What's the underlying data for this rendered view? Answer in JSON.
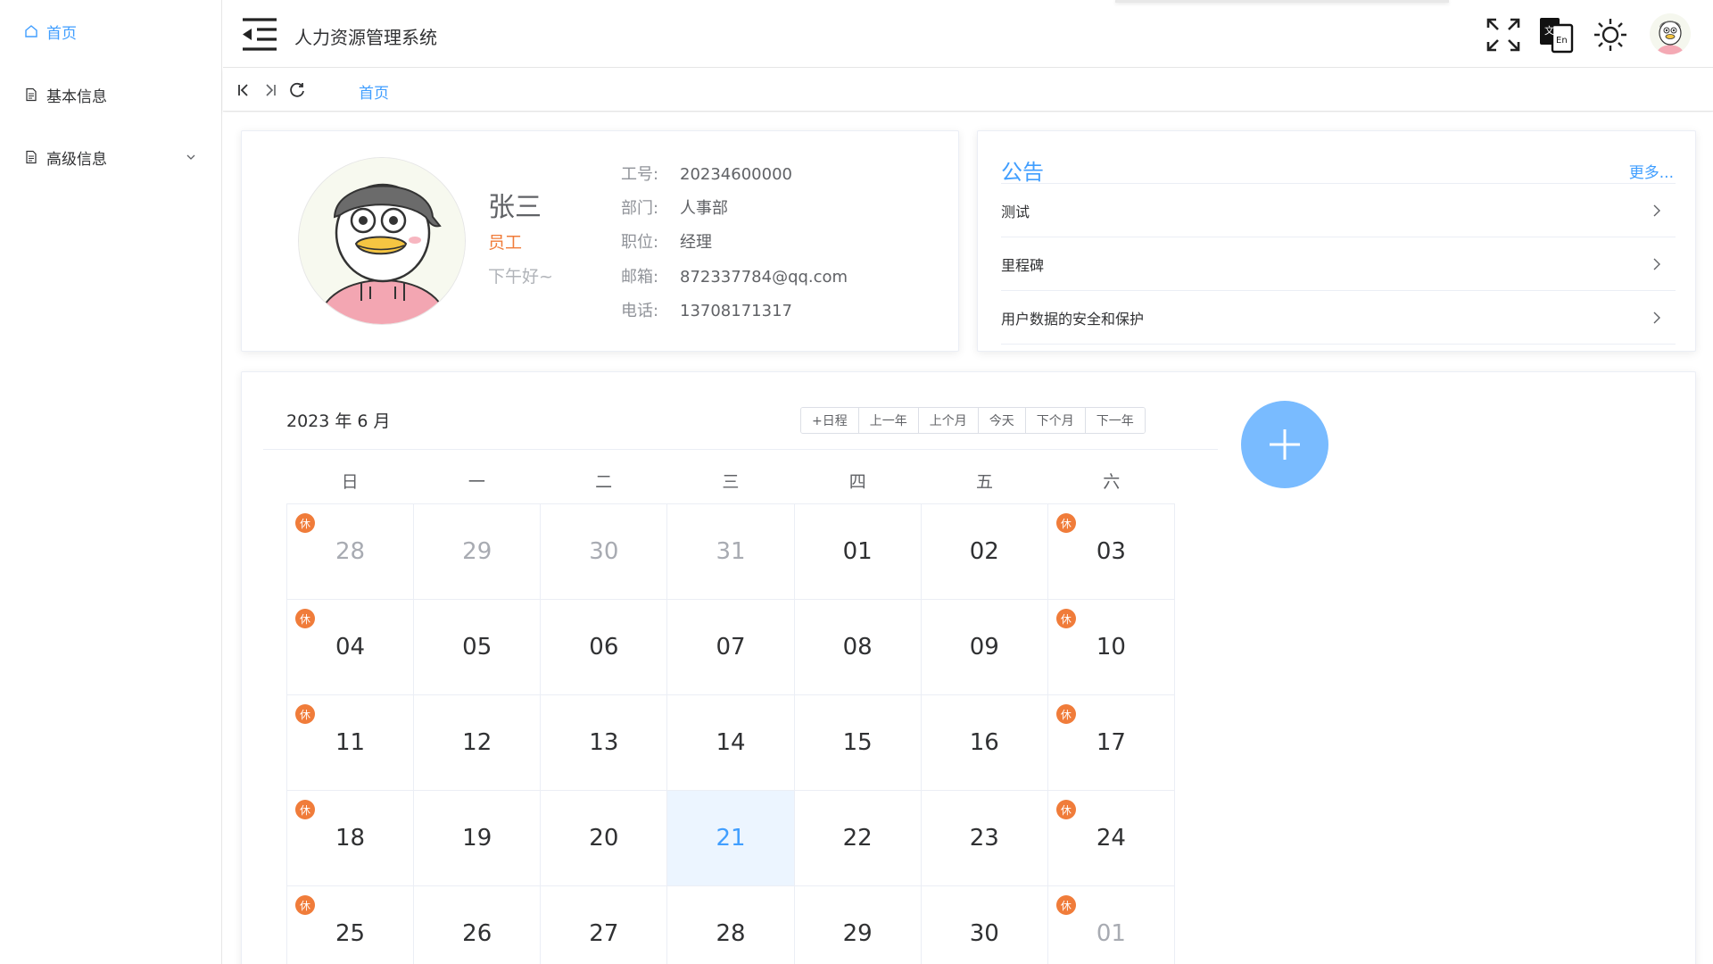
{
  "sidebar": {
    "items": [
      {
        "label": "首页",
        "icon": "home-icon",
        "active": true
      },
      {
        "label": "基本信息",
        "icon": "document-icon"
      },
      {
        "label": "高级信息",
        "icon": "document-icon",
        "expandable": true
      }
    ]
  },
  "header": {
    "title": "人力资源管理系统",
    "icons": [
      "menu-fold-icon",
      "fullscreen-icon",
      "translate-icon",
      "sun-icon",
      "avatar"
    ],
    "translate_glyphs": {
      "zh": "文",
      "en": "En"
    }
  },
  "tabs": {
    "controls": [
      "first-page-icon",
      "last-page-icon",
      "refresh-icon"
    ],
    "items": [
      {
        "label": "首页",
        "active": true
      }
    ]
  },
  "profile": {
    "name": "张三",
    "role": "员工",
    "greeting": "下午好~",
    "fields": [
      {
        "label": "工号:",
        "value": "20234600000"
      },
      {
        "label": "部门:",
        "value": "人事部"
      },
      {
        "label": "职位:",
        "value": "经理"
      },
      {
        "label": "邮箱:",
        "value": "872337784@qq.com"
      },
      {
        "label": "电话:",
        "value": "13708171317"
      }
    ]
  },
  "notice": {
    "title": "公告",
    "more": "更多...",
    "items": [
      "测试",
      "里程碑",
      "用户数据的安全和保护"
    ]
  },
  "calendar": {
    "title": "2023 年 6 月",
    "buttons": [
      "+日程",
      "上一年",
      "上个月",
      "今天",
      "下个月",
      "下一年"
    ],
    "weekdays": [
      "日",
      "一",
      "二",
      "三",
      "四",
      "五",
      "六"
    ],
    "rest_badge": "休",
    "weeks": [
      [
        "28",
        "29",
        "30",
        "31",
        "01",
        "02",
        "03"
      ],
      [
        "04",
        "05",
        "06",
        "07",
        "08",
        "09",
        "10"
      ],
      [
        "11",
        "12",
        "13",
        "14",
        "15",
        "16",
        "17"
      ],
      [
        "18",
        "19",
        "20",
        "21",
        "22",
        "23",
        "24"
      ],
      [
        "25",
        "26",
        "27",
        "28",
        "29",
        "30",
        "01"
      ]
    ],
    "today": "21",
    "colors": {
      "accent": "#409eff",
      "rest": "#f07c3a",
      "today_bg": "#ecf5ff",
      "fab": "#79bbff"
    }
  }
}
